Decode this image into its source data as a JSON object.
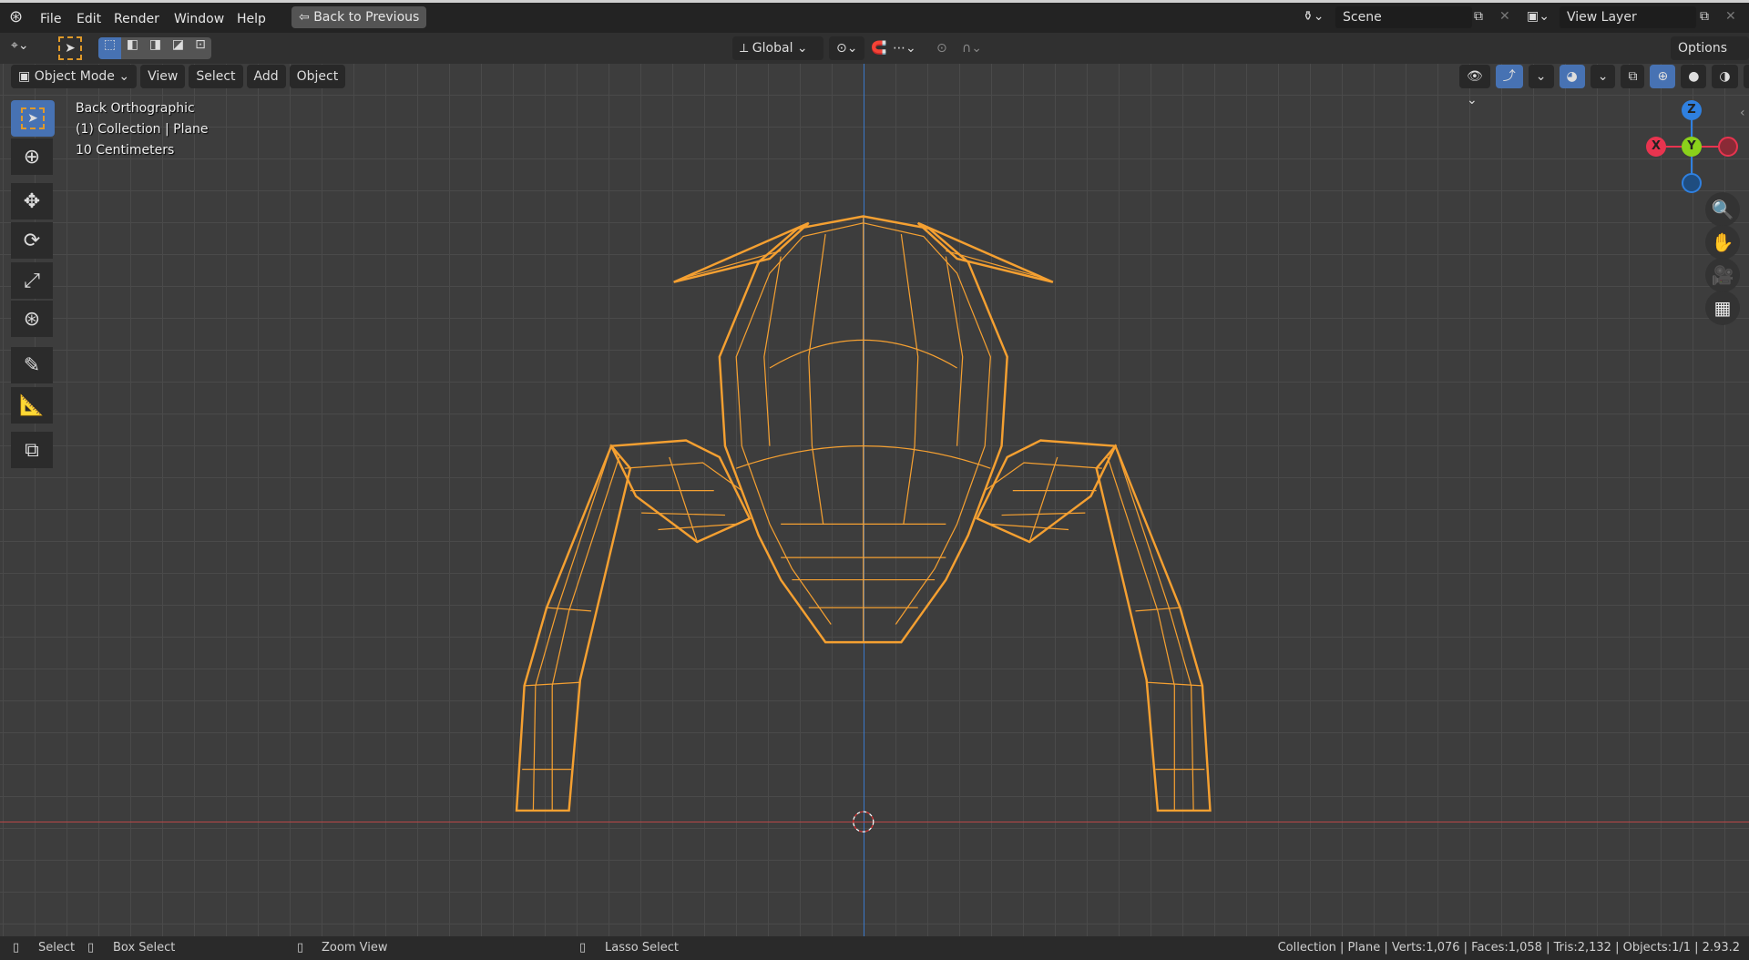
{
  "menubar": {
    "items": [
      "File",
      "Edit",
      "Render",
      "Window",
      "Help"
    ],
    "back_button": "Back to Previous",
    "scene": "Scene",
    "view_layer": "View Layer"
  },
  "header": {
    "transform_orientation": "Global",
    "options": "Options"
  },
  "viewport_header": {
    "mode": "Object Mode",
    "menus": [
      "View",
      "Select",
      "Add",
      "Object"
    ]
  },
  "overlay": {
    "view_name": "Back Orthographic",
    "collection": "(1) Collection | Plane",
    "scale": "10 Centimeters"
  },
  "gizmo": {
    "z": "Z",
    "x": "X",
    "y": "Y"
  },
  "status": {
    "select": "Select",
    "box_select": "Box Select",
    "zoom_view": "Zoom View",
    "lasso_select": "Lasso Select",
    "stats": "Collection | Plane | Verts:1,076 | Faces:1,058 | Tris:2,132 | Objects:1/1 | 2.93.2"
  },
  "colors": {
    "wire": "#f5a031",
    "accent": "#4772b3",
    "x_axis": "#e8344f",
    "y_axis": "#8ad11b",
    "z_axis": "#2f80e0"
  }
}
